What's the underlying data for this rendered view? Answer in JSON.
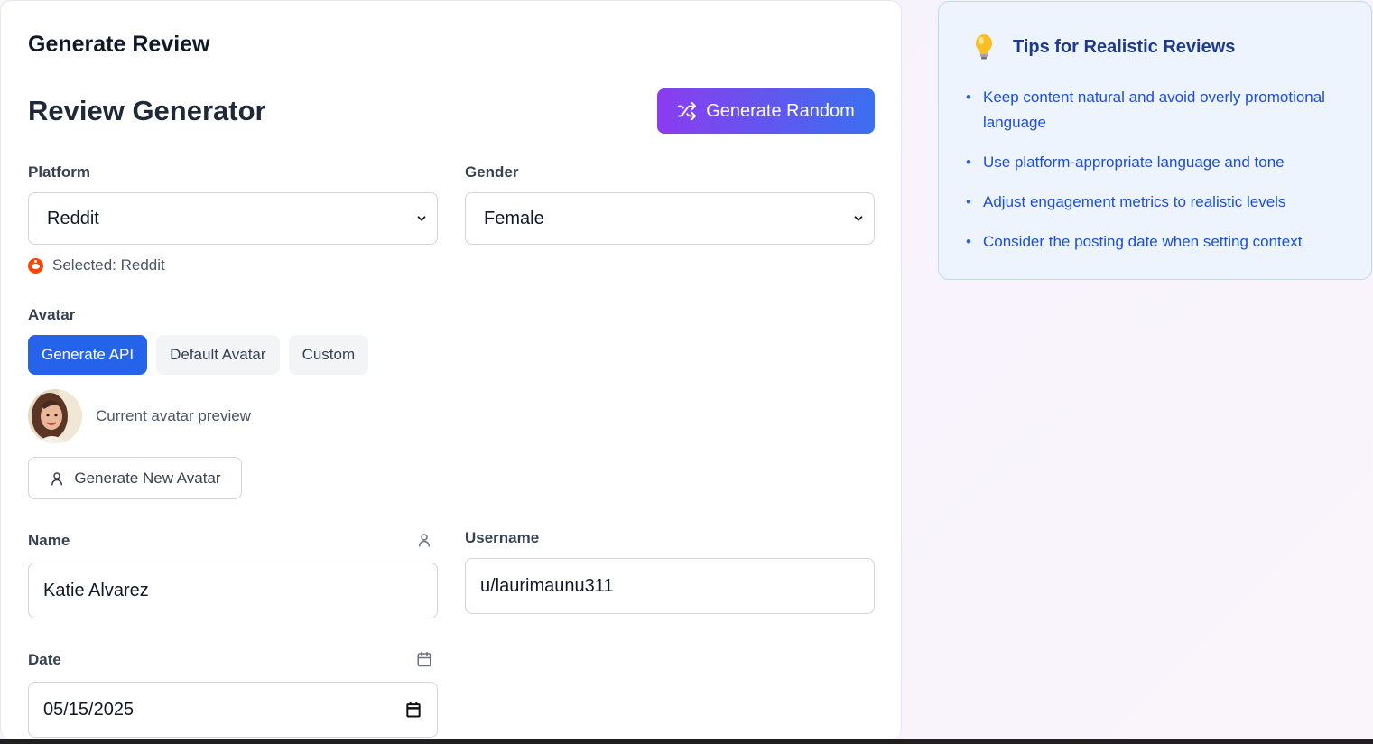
{
  "page": {
    "title": "Generate Review"
  },
  "generator": {
    "title": "Review Generator",
    "random_button": "Generate Random"
  },
  "platform": {
    "label": "Platform",
    "value": "Reddit",
    "selected_text": "Selected: Reddit"
  },
  "gender": {
    "label": "Gender",
    "value": "Female"
  },
  "avatar": {
    "label": "Avatar",
    "tabs": [
      {
        "label": "Generate API",
        "active": true
      },
      {
        "label": "Default Avatar",
        "active": false
      },
      {
        "label": "Custom",
        "active": false
      }
    ],
    "preview_caption": "Current avatar preview",
    "generate_button": "Generate New Avatar"
  },
  "name": {
    "label": "Name",
    "value": "Katie Alvarez"
  },
  "username": {
    "label": "Username",
    "value": "u/laurimaunu311"
  },
  "date": {
    "label": "Date",
    "value": "05/15/2025"
  },
  "tips": {
    "title": "Tips for Realistic Reviews",
    "items": [
      "Keep content natural and avoid overly promotional language",
      "Use platform-appropriate language and tone",
      "Adjust engagement metrics to realistic levels",
      "Consider the posting date when setting context"
    ]
  },
  "colors": {
    "accent_blue": "#2563eb",
    "gradient_start": "#8b3cf0",
    "gradient_end": "#3b6ff0",
    "reddit_orange": "#ff4500",
    "tips_background": "#eef4fd"
  },
  "icons": {
    "random": "shuffle-icon",
    "platform": "reddit-icon",
    "avatar_button": "user-icon",
    "name_field": "user-icon",
    "date_field": "calendar-icon",
    "tips": "lightbulb-icon"
  }
}
